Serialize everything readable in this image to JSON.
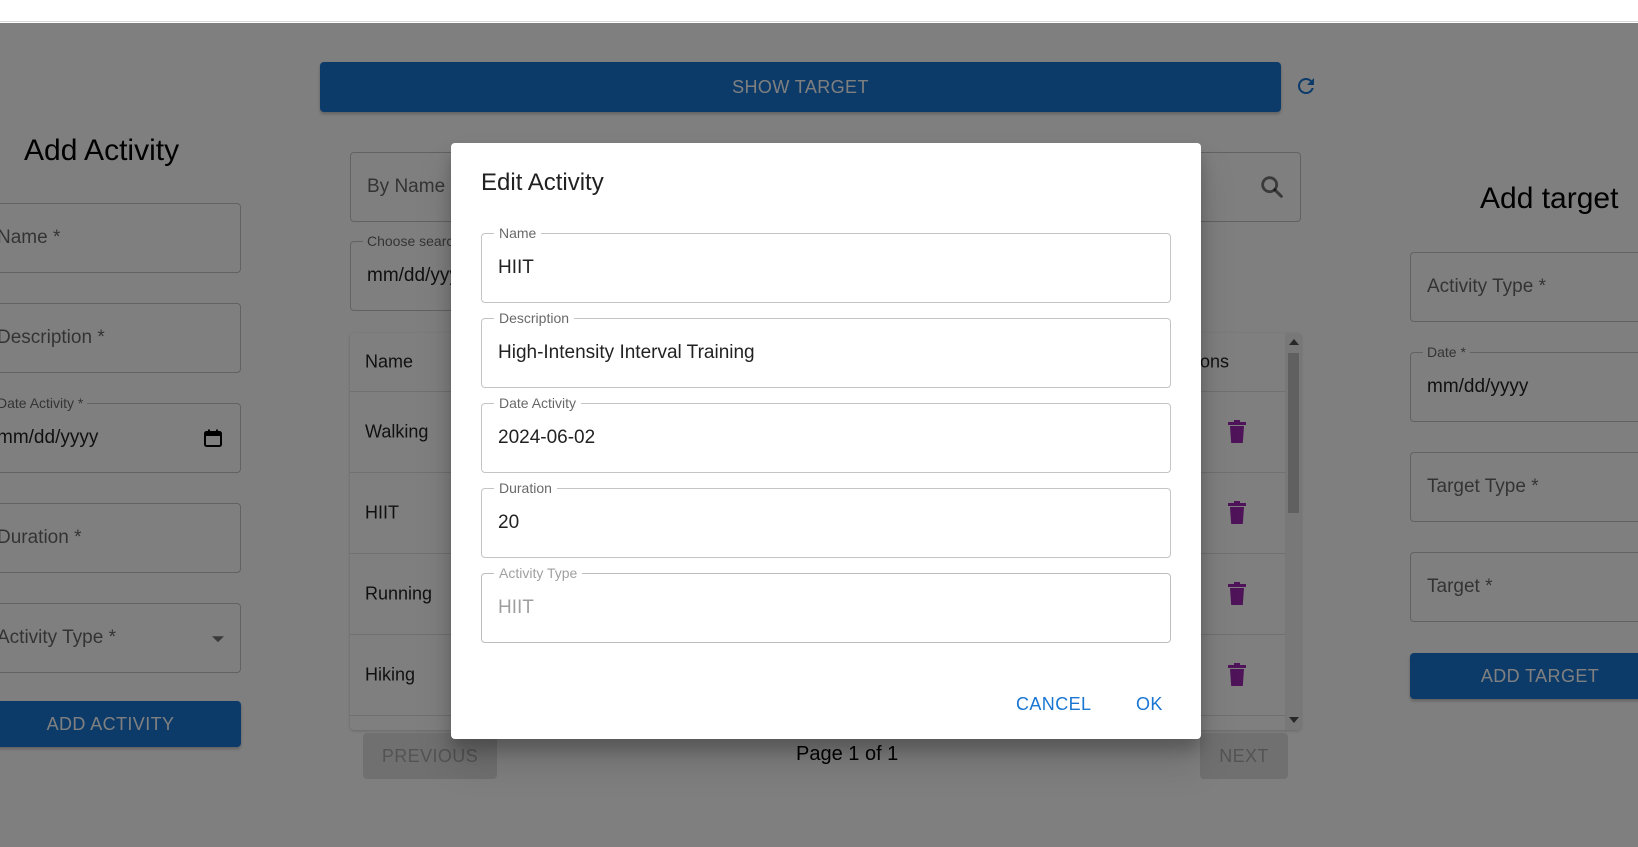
{
  "colors": {
    "primary": "#1976d2",
    "delete": "#9c27b0",
    "overlay": "rgba(0,0,0,0.5)"
  },
  "header": {
    "show_target_label": "SHOW TARGET",
    "refresh_icon": "refresh-icon"
  },
  "add_activity": {
    "title": "Add Activity",
    "name_placeholder": "Name *",
    "description_placeholder": "Description *",
    "date_label": "Date Activity *",
    "date_value": "mm/dd/yyyy",
    "duration_placeholder": "Duration *",
    "activity_type_placeholder": "Activity Type *",
    "submit_label": "ADD ACTIVITY"
  },
  "search": {
    "name_placeholder": "By Name",
    "date_label": "Choose search date",
    "date_value": "mm/dd/yyyy"
  },
  "table": {
    "columns": [
      "Name",
      "Actions"
    ],
    "rows": [
      {
        "name": "Walking"
      },
      {
        "name": "HIIT"
      },
      {
        "name": "Running"
      },
      {
        "name": "Hiking"
      }
    ]
  },
  "pagination": {
    "previous_label": "PREVIOUS",
    "page_text": "Page 1 of 1",
    "next_label": "NEXT"
  },
  "add_target": {
    "title": "Add target",
    "activity_type_placeholder": "Activity Type *",
    "date_label": "Date *",
    "date_value": "mm/dd/yyyy",
    "target_type_placeholder": "Target Type *",
    "target_placeholder": "Target *",
    "submit_label": "ADD TARGET"
  },
  "dialog": {
    "title": "Edit Activity",
    "fields": [
      {
        "label": "Name",
        "value": "HIIT"
      },
      {
        "label": "Description",
        "value": "High-Intensity Interval Training"
      },
      {
        "label": "Date Activity",
        "value": "2024-06-02"
      },
      {
        "label": "Duration",
        "value": "20"
      },
      {
        "label": "Activity Type",
        "value": "HIIT"
      }
    ],
    "cancel_label": "CANCEL",
    "ok_label": "OK"
  }
}
